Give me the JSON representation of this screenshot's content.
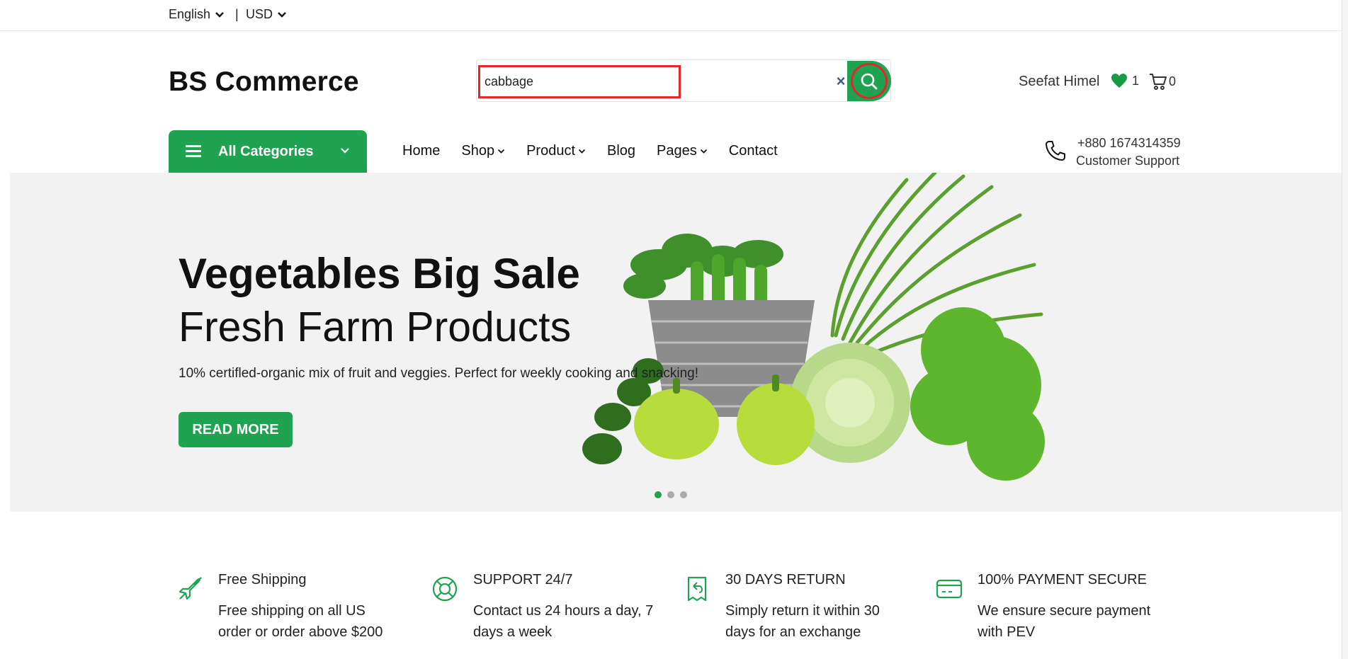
{
  "topbar": {
    "language": "English",
    "separator": "|",
    "currency": "USD"
  },
  "header": {
    "logo": "BS Commerce",
    "search": {
      "value": "cabbage",
      "clear": "×"
    },
    "user_name": "Seefat Himel",
    "wishlist_count": "1",
    "cart_count": "0"
  },
  "nav": {
    "categories_label": "All Categories",
    "items": [
      "Home",
      "Shop",
      "Product",
      "Blog",
      "Pages",
      "Contact"
    ],
    "phone": "+880 1674314359",
    "phone_label": "Customer Support"
  },
  "hero": {
    "title": "Vegetables Big Sale",
    "subtitle": "Fresh Farm Products",
    "description": "10% certifled-organic mix of fruit and veggies. Perfect for weekly cooking and snacking!",
    "button": "READ MORE",
    "active_slide": 1,
    "slide_count": 3
  },
  "features": [
    {
      "icon": "plane-icon",
      "title": "Free Shipping",
      "desc": "Free shipping on all US order or order above $200"
    },
    {
      "icon": "lifebuoy-icon",
      "title": "SUPPORT 24/7",
      "desc": "Contact us 24 hours a day, 7 days a week"
    },
    {
      "icon": "return-icon",
      "title": "30 DAYS RETURN",
      "desc": "Simply return it within 30 days for an exchange"
    },
    {
      "icon": "card-icon",
      "title": "100% PAYMENT SECURE",
      "desc": "We ensure secure payment with PEV"
    }
  ],
  "colors": {
    "accent": "#1fa350",
    "highlight": "#e3262b"
  }
}
